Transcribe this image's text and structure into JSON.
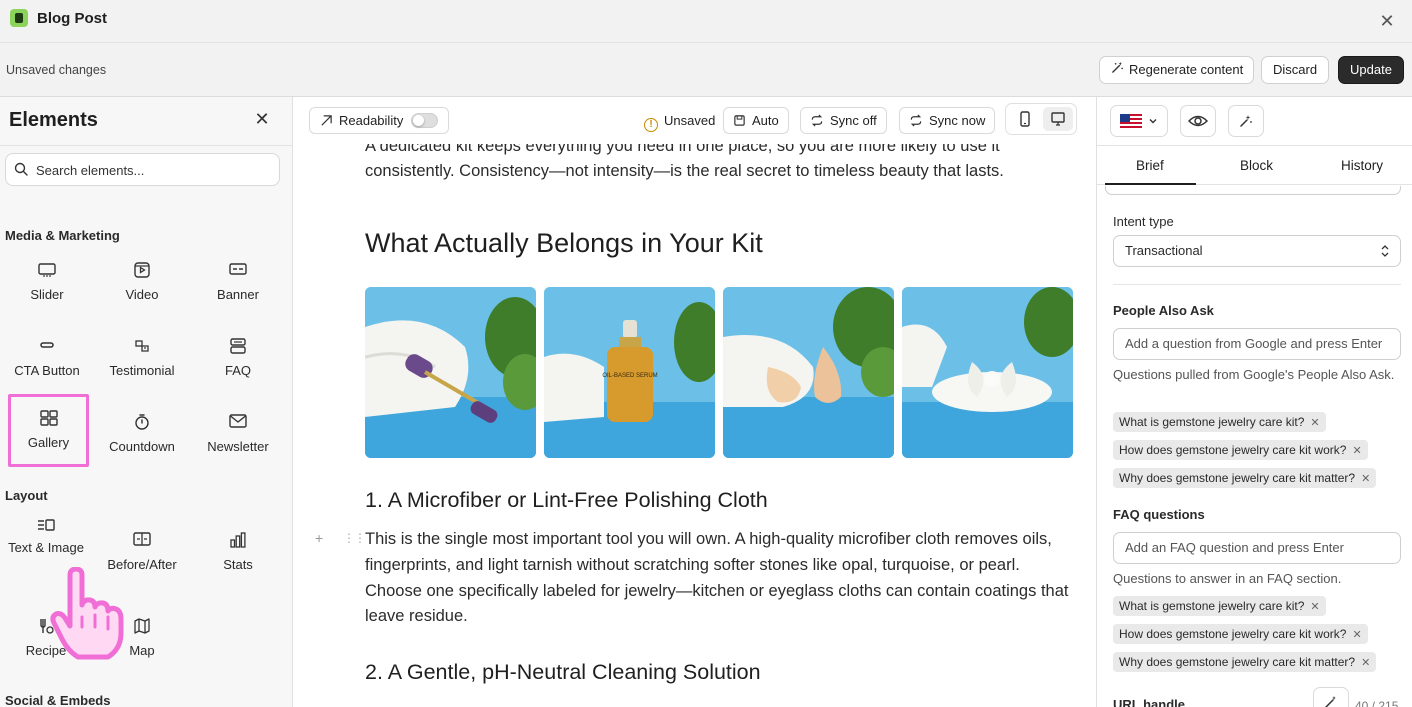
{
  "window": {
    "title": "Blog Post"
  },
  "actionbar": {
    "status": "Unsaved changes",
    "regenerate_label": "Regenerate content",
    "discard_label": "Discard",
    "update_label": "Update"
  },
  "sidebar": {
    "title": "Elements",
    "search_placeholder": "Search elements...",
    "sections": [
      {
        "label": "Media & Marketing",
        "items": [
          {
            "label": "Slider",
            "icon": "slider-icon"
          },
          {
            "label": "Video",
            "icon": "video-icon"
          },
          {
            "label": "Banner",
            "icon": "banner-icon"
          },
          {
            "label": "CTA Button",
            "icon": "cta-button-icon"
          },
          {
            "label": "Testimonial",
            "icon": "testimonial-icon"
          },
          {
            "label": "FAQ",
            "icon": "faq-icon"
          },
          {
            "label": "Gallery",
            "icon": "gallery-icon"
          },
          {
            "label": "Countdown",
            "icon": "countdown-icon"
          },
          {
            "label": "Newsletter",
            "icon": "newsletter-icon"
          }
        ]
      },
      {
        "label": "Layout",
        "items": [
          {
            "label": "Text & Image",
            "icon": "text-image-icon"
          },
          {
            "label": "Before/After",
            "icon": "before-after-icon"
          },
          {
            "label": "Stats",
            "icon": "stats-icon"
          },
          {
            "label": "Recipe",
            "icon": "recipe-icon"
          },
          {
            "label": "Map",
            "icon": "map-icon"
          }
        ]
      },
      {
        "label": "Social & Embeds",
        "items": []
      }
    ]
  },
  "editor_toolbar": {
    "readability_label": "Readability",
    "readability_on": false,
    "status": "Unsaved",
    "auto_label": "Auto",
    "sync_off_label": "Sync off",
    "sync_now_label": "Sync now"
  },
  "article": {
    "intro_line1": "A dedicated kit keeps everything you need in one place, so you are more likely to use it",
    "intro_line2": "consistently. Consistency—not intensity—is the real secret to timeless beauty that lasts.",
    "heading": "What Actually Belongs in Your Kit",
    "section1_title": "1. A Microfiber or Lint-Free Polishing Cloth",
    "section1_body": "This is the single most important tool you will own. A high-quality microfiber cloth removes oils, fingerprints, and light tarnish without scratching softer stones like opal, turquoise, or pearl. Choose one specifically labeled for jewelry—kitchen or eyeglass cloths can contain coatings that leave residue.",
    "section2_title": "2. A Gentle, pH-Neutral Cleaning Solution",
    "serum_label": "OIL-BASED SERUM"
  },
  "right_panel": {
    "tabs": [
      "Brief",
      "Block",
      "History"
    ],
    "active_tab": "Brief",
    "intent_label": "Intent type",
    "intent_value": "Transactional",
    "paa_label": "People Also Ask",
    "paa_placeholder": "Add a question from Google and press Enter",
    "paa_help": "Questions pulled from Google's People Also Ask.",
    "paa_tags": [
      "What is gemstone jewelry care kit?",
      "How does gemstone jewelry care kit work?",
      "Why does gemstone jewelry care kit matter?"
    ],
    "faq_label": "FAQ questions",
    "faq_placeholder": "Add an FAQ question and press Enter",
    "faq_help": "Questions to answer in an FAQ section.",
    "faq_tags": [
      "What is gemstone jewelry care kit?",
      "How does gemstone jewelry care kit work?",
      "Why does gemstone jewelry care kit matter?"
    ],
    "url_label": "URL handle",
    "url_count": "40 / 215"
  },
  "colors": {
    "highlight": "#f06fd6",
    "accent_dark": "#2b2b2b",
    "warning": "#c58a00"
  }
}
